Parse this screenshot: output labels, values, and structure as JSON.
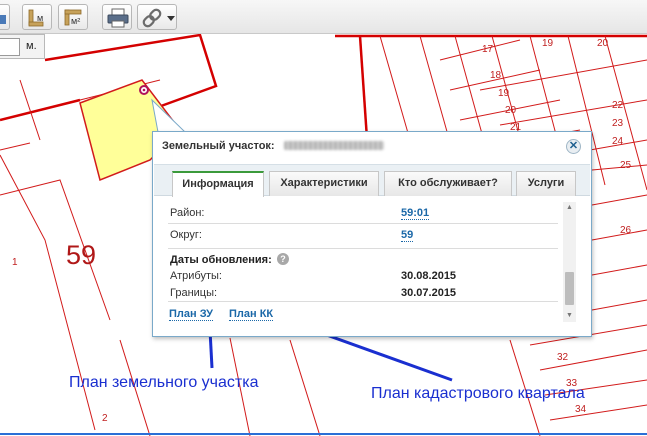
{
  "toolbar": {
    "buttons": [
      {
        "name": "home-icon"
      },
      {
        "name": "measure-length-icon",
        "label": "м"
      },
      {
        "name": "measure-area-icon",
        "label": "м²"
      },
      {
        "name": "print-icon"
      },
      {
        "name": "link-icon",
        "dropdown": true
      }
    ]
  },
  "scale": {
    "value": "",
    "unit": "м."
  },
  "map": {
    "big_label": "59",
    "labels": [
      {
        "text": "1"
      },
      {
        "text": "2"
      },
      {
        "text": "17"
      },
      {
        "text": "19"
      },
      {
        "text": "20"
      },
      {
        "text": "18"
      },
      {
        "text": "19"
      },
      {
        "text": "20"
      },
      {
        "text": "21"
      },
      {
        "text": "22"
      },
      {
        "text": "23"
      },
      {
        "text": "24"
      },
      {
        "text": "25"
      },
      {
        "text": "26"
      },
      {
        "text": "32"
      },
      {
        "text": "33"
      },
      {
        "text": "34"
      }
    ]
  },
  "popup": {
    "title": "Земельный участок:",
    "tabs": [
      {
        "label": "Информация",
        "active": true
      },
      {
        "label": "Характеристики",
        "active": false
      },
      {
        "label": "Кто обслуживает?",
        "active": false
      },
      {
        "label": "Услуги",
        "active": false
      }
    ],
    "rows": [
      {
        "label": "Район:",
        "value": "59:01",
        "link": true
      },
      {
        "label": "Округ:",
        "value": "59",
        "link": true
      }
    ],
    "updates_title": "Даты обновления:",
    "update_rows": [
      {
        "label": "Атрибуты:",
        "value": "30.08.2015"
      },
      {
        "label": "Границы:",
        "value": "30.07.2015"
      }
    ],
    "links": [
      {
        "label": "План ЗУ"
      },
      {
        "label": "План КК"
      }
    ]
  },
  "annotations": {
    "left": "План земельного участка",
    "right": "План кадастрового квартала"
  },
  "colors": {
    "parcel_border": "#d40000",
    "selected_fill": "#ffff99",
    "annotation": "#1a2fd0",
    "link": "#1b68a8",
    "active_tab": "#3b9a3b"
  }
}
